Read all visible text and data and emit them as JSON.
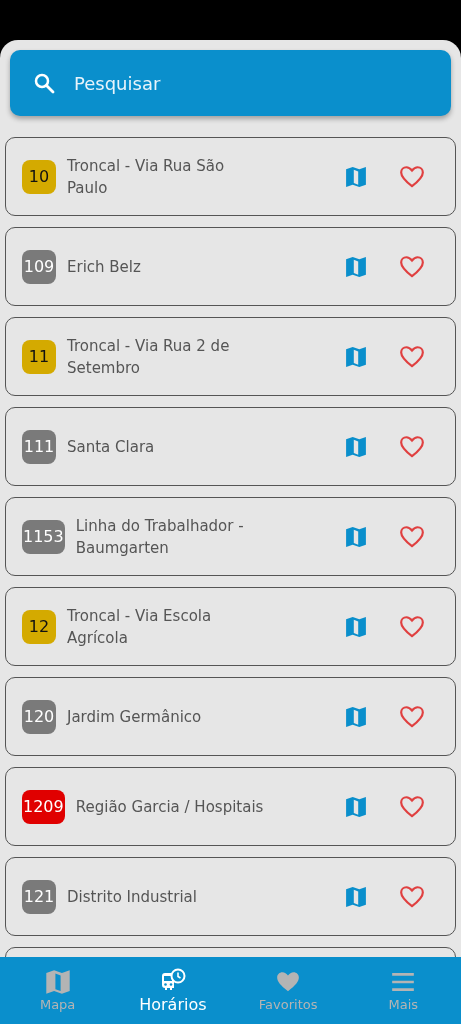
{
  "search": {
    "placeholder": "Pesquisar"
  },
  "routes": [
    {
      "number": "10",
      "name": "Troncal - Via Rua São Paulo",
      "color": "#d4aa00",
      "favorite": false
    },
    {
      "number": "109",
      "name": "Erich Belz",
      "color": "#7a7a7a",
      "favorite": false
    },
    {
      "number": "11",
      "name": "Troncal - Via Rua 2 de Setembro",
      "color": "#d4aa00",
      "favorite": false
    },
    {
      "number": "111",
      "name": "Santa Clara",
      "color": "#7a7a7a",
      "favorite": false
    },
    {
      "number": "1153",
      "name": "Linha do Trabalhador - Baumgarten",
      "color": "#7a7a7a",
      "favorite": false
    },
    {
      "number": "12",
      "name": "Troncal - Via Escola Agrícola",
      "color": "#d4aa00",
      "favorite": false
    },
    {
      "number": "120",
      "name": "Jardim Germânico",
      "color": "#7a7a7a",
      "favorite": false
    },
    {
      "number": "1209",
      "name": "Região Garcia / Hospitais",
      "color": "#e00000",
      "favorite": false
    },
    {
      "number": "121",
      "name": "Distrito Industrial",
      "color": "#7a7a7a",
      "favorite": false
    }
  ],
  "nav": [
    {
      "kind": "map",
      "label": "Mapa",
      "selected": false
    },
    {
      "kind": "bus",
      "label": "Horários",
      "selected": true
    },
    {
      "kind": "heart",
      "label": "Favoritos",
      "selected": false
    },
    {
      "kind": "menu",
      "label": "Mais",
      "selected": false
    }
  ]
}
